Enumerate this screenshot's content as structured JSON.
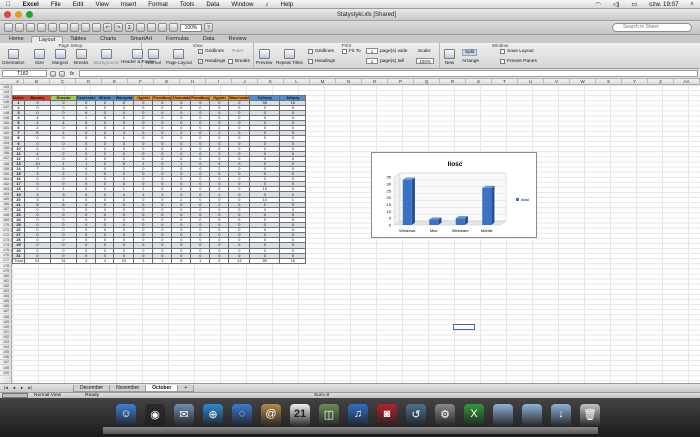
{
  "menubar": {
    "apple": "",
    "app": "Excel",
    "items": [
      "File",
      "Edit",
      "View",
      "Insert",
      "Format",
      "Tools",
      "Data",
      "Window",
      "♪",
      "Help"
    ],
    "clock": "czw. 19:07"
  },
  "window": {
    "title": "Statystyki.xls  [Shared]"
  },
  "toolbar": {
    "zoom": "100%",
    "search_placeholder": "Search in Sheet"
  },
  "ribbon_tabs": [
    "Home",
    "Layout",
    "Tables",
    "Charts",
    "SmartArt",
    "Formulas",
    "Data",
    "Review"
  ],
  "ribbon_active": "Layout",
  "ribbon": {
    "page_setup": "Page Setup",
    "orientation": "Orientation",
    "size": "Size",
    "margins": "Margins",
    "breaks": "Breaks",
    "background": "Background",
    "header_footer": "Header & Footer",
    "view": "View",
    "normal": "Normal",
    "page_layout": "Page Layout",
    "gridlines_view": "Gridlines",
    "headings_view": "Headings",
    "ruler": "Ruler",
    "breaks_view": "Breaks",
    "print": "Print",
    "preview": "Preview",
    "repeat_titles": "Repeat Titles",
    "gridlines_print": "Gridlines",
    "headings_print": "Headings",
    "fit_to": "Fit To",
    "fit_wide_value": "1",
    "fit_wide_label": "page(s) wide",
    "fit_tall_value": "1",
    "fit_tall_label": "page(s) tall",
    "scale": "Scale:",
    "scale_value": "100%",
    "window": "Window",
    "new": "New",
    "split": "Split",
    "arrange": "Arrange",
    "save_layout": "Save Layout",
    "freeze_panes": "Freeze Panes"
  },
  "formula": {
    "cell": "T182",
    "fx": "fx",
    "value": ""
  },
  "columns": [
    "A",
    "B",
    "C",
    "D",
    "E",
    "F",
    "G",
    "H",
    "I",
    "J",
    "K",
    "L",
    "M",
    "N",
    "O",
    "P",
    "Q",
    "R",
    "S",
    "T",
    "U",
    "V",
    "W",
    "X",
    "Y",
    "Z",
    "AA",
    "AB",
    "AC"
  ],
  "rows": [
    "143",
    "144",
    "145",
    "146",
    "147",
    "148",
    "149",
    "150",
    "151",
    "152",
    "153",
    "154",
    "155",
    "156",
    "157",
    "158",
    "159",
    "160",
    "161",
    "162",
    "163",
    "164",
    "165",
    "166",
    "167",
    "168",
    "169",
    "170",
    "171",
    "172",
    "173",
    "174",
    "175",
    "176",
    "177",
    "178",
    "179",
    "180",
    "181",
    "182",
    "183",
    "184",
    "185",
    "186",
    "187",
    "188",
    "189",
    "190",
    "191",
    "192",
    "193",
    "194",
    "195",
    "196",
    "197",
    "198",
    "199"
  ],
  "table": {
    "headers": [
      "Dzień",
      "Banany",
      "Gruszki",
      "Czereśnie",
      "Wiśnie",
      "Warzywa",
      "Ogórki",
      "Pomidory",
      "Ziemniaki",
      "Pomidory",
      "Ogórki",
      "Marchewki",
      "Cytryny",
      "Arbuzy"
    ],
    "header_colors": [
      "#e8412a",
      "#e8412a",
      "#a9cc4a",
      "#4b8fd6",
      "#4b8fd6",
      "#4b8fd6",
      "#f0932b",
      "#f0932b",
      "#f0932b",
      "#f0932b",
      "#f0932b",
      "#f0932b",
      "#4b8fd6",
      "#4b8fd6"
    ],
    "rows": [
      [
        "1",
        "0",
        "0",
        "0",
        "0",
        "0",
        "0",
        "0",
        "0",
        "0",
        "0",
        "0",
        "55",
        "15"
      ],
      [
        "2",
        "0",
        "0",
        "0",
        "0",
        "0",
        "0",
        "0",
        "0",
        "0",
        "0",
        "0",
        "0",
        "0"
      ],
      [
        "3",
        "0",
        "0",
        "0",
        "0",
        "0",
        "0",
        "0",
        "0",
        "0",
        "0",
        "0",
        "0",
        "0"
      ],
      [
        "4",
        "4",
        "3",
        "1",
        "0",
        "0",
        "0",
        "0",
        "0",
        "0",
        "0",
        "0",
        "0",
        "0"
      ],
      [
        "5",
        "4",
        "4",
        "0",
        "0",
        "0",
        "0",
        "0",
        "0",
        "0",
        "0",
        "0",
        "0",
        "0"
      ],
      [
        "6",
        "2",
        "0",
        "0",
        "0",
        "2",
        "0",
        "0",
        "0",
        "0",
        "2",
        "0",
        "0",
        "0"
      ],
      [
        "7",
        "6",
        "1",
        "0",
        "2",
        "3",
        "0",
        "0",
        "2",
        "0",
        "1",
        "0",
        "0",
        "0"
      ],
      [
        "8",
        "0",
        "0",
        "0",
        "0",
        "1",
        "0",
        "0",
        "0",
        "0",
        "0",
        "0",
        "0",
        "0"
      ],
      [
        "9",
        "0",
        "0",
        "0",
        "0",
        "0",
        "0",
        "0",
        "0",
        "0",
        "0",
        "0",
        "0",
        "0"
      ],
      [
        "10",
        "0",
        "0",
        "0",
        "0",
        "0",
        "0",
        "0",
        "0",
        "0",
        "0",
        "0",
        "0",
        "0"
      ],
      [
        "11",
        "4",
        "2",
        "0",
        "2",
        "0",
        "0",
        "0",
        "0",
        "0",
        "2",
        "0",
        "0",
        "0"
      ],
      [
        "12",
        "0",
        "0",
        "0",
        "0",
        "0",
        "0",
        "0",
        "0",
        "0",
        "0",
        "0",
        "0",
        "0"
      ],
      [
        "13",
        "10",
        "1",
        "1",
        "2",
        "6",
        "1",
        "0",
        "1",
        "0",
        "4",
        "0",
        "0",
        "0"
      ],
      [
        "14",
        "7",
        "5",
        "0",
        "0",
        "2",
        "0",
        "0",
        "0",
        "0",
        "2",
        "0",
        "0",
        "0"
      ],
      [
        "15",
        "3",
        "2",
        "1",
        "0",
        "0",
        "0",
        "0",
        "0",
        "0",
        "0",
        "0",
        "0",
        "0"
      ],
      [
        "16",
        "0",
        "0",
        "0",
        "0",
        "0",
        "0",
        "0",
        "0",
        "0",
        "0",
        "0",
        "0",
        "0"
      ],
      [
        "17",
        "0",
        "0",
        "0",
        "0",
        "0",
        "0",
        "0",
        "0",
        "0",
        "0",
        "0",
        "0",
        "0"
      ],
      [
        "18",
        "2",
        "1",
        "0",
        "0",
        "1",
        "1",
        "0",
        "0",
        "0",
        "0",
        "0",
        "15",
        "0"
      ],
      [
        "19",
        "3",
        "3",
        "0",
        "0",
        "4",
        "1",
        "1",
        "0",
        "0",
        "1",
        "0",
        "3",
        "0"
      ],
      [
        "20",
        "3",
        "1",
        "0",
        "0",
        "2",
        "0",
        "0",
        "2",
        "0",
        "0",
        "0",
        "10",
        "1"
      ],
      [
        "21",
        "5",
        "6",
        "0",
        "0",
        "0",
        "0",
        "0",
        "0",
        "0",
        "2",
        "0",
        "2",
        "0"
      ],
      [
        "22",
        "0",
        "0",
        "0",
        "0",
        "0",
        "0",
        "0",
        "0",
        "0",
        "0",
        "0",
        "0",
        "0"
      ],
      [
        "23",
        "0",
        "0",
        "0",
        "0",
        "0",
        "0",
        "0",
        "0",
        "0",
        "0",
        "0",
        "0",
        "0"
      ],
      [
        "24",
        "0",
        "0",
        "0",
        "0",
        "0",
        "0",
        "0",
        "0",
        "0",
        "0",
        "0",
        "0",
        "0"
      ],
      [
        "25",
        "0",
        "0",
        "0",
        "0",
        "0",
        "0",
        "0",
        "0",
        "0",
        "0",
        "0",
        "0",
        "0"
      ],
      [
        "26",
        "0",
        "0",
        "0",
        "0",
        "0",
        "0",
        "0",
        "0",
        "0",
        "0",
        "0",
        "0",
        "0"
      ],
      [
        "27",
        "0",
        "0",
        "0",
        "0",
        "0",
        "0",
        "0",
        "0",
        "0",
        "0",
        "0",
        "0",
        "0"
      ],
      [
        "28",
        "0",
        "0",
        "0",
        "0",
        "0",
        "0",
        "0",
        "0",
        "0",
        "0",
        "0",
        "0",
        "0"
      ],
      [
        "29",
        "0",
        "0",
        "0",
        "0",
        "0",
        "0",
        "0",
        "0",
        "0",
        "0",
        "0",
        "0",
        "0"
      ],
      [
        "30",
        "0",
        "0",
        "0",
        "0",
        "0",
        "0",
        "0",
        "0",
        "0",
        "0",
        "0",
        "0",
        "0"
      ],
      [
        "31",
        "0",
        "0",
        "0",
        "0",
        "0",
        "0",
        "0",
        "0",
        "0",
        "0",
        "0",
        "0",
        "0"
      ]
    ],
    "total": [
      "Total",
      "61",
      "31",
      "3",
      "4",
      "23",
      "3",
      "1",
      "5",
      "1",
      "0",
      "13",
      "85",
      "16"
    ]
  },
  "chart_data": {
    "type": "bar",
    "title": "Ilość",
    "categories": [
      "Windows",
      "Mac",
      "Webware",
      "Mobile"
    ],
    "series": [
      {
        "name": "Ilość",
        "values": [
          33,
          4,
          5,
          27
        ]
      }
    ],
    "ylim": [
      0,
      35
    ],
    "yticks": [
      0,
      5,
      10,
      15,
      20,
      25,
      30,
      35
    ],
    "legend_position": "right",
    "bar_color": "#3b73c4",
    "grid": true
  },
  "sheet_tabs": [
    "December",
    "November",
    "October"
  ],
  "sheet_active": "October",
  "sheet_add": "+",
  "status": {
    "view": "Normal View",
    "ready": "Ready",
    "sum": "Sum=0"
  },
  "dock_icons": [
    "finder-icon",
    "dashboard-icon",
    "mail-icon",
    "safari-icon",
    "ichat-icon",
    "address-book-icon",
    "ical-icon",
    "preview-icon",
    "itunes-icon",
    "photo-booth-icon",
    "time-machine-icon",
    "system-preferences-icon",
    "excel-icon",
    "applications-folder-icon",
    "documents-folder-icon",
    "downloads-icon",
    "trash-icon"
  ],
  "dock_labels": {
    "ical": "21"
  }
}
